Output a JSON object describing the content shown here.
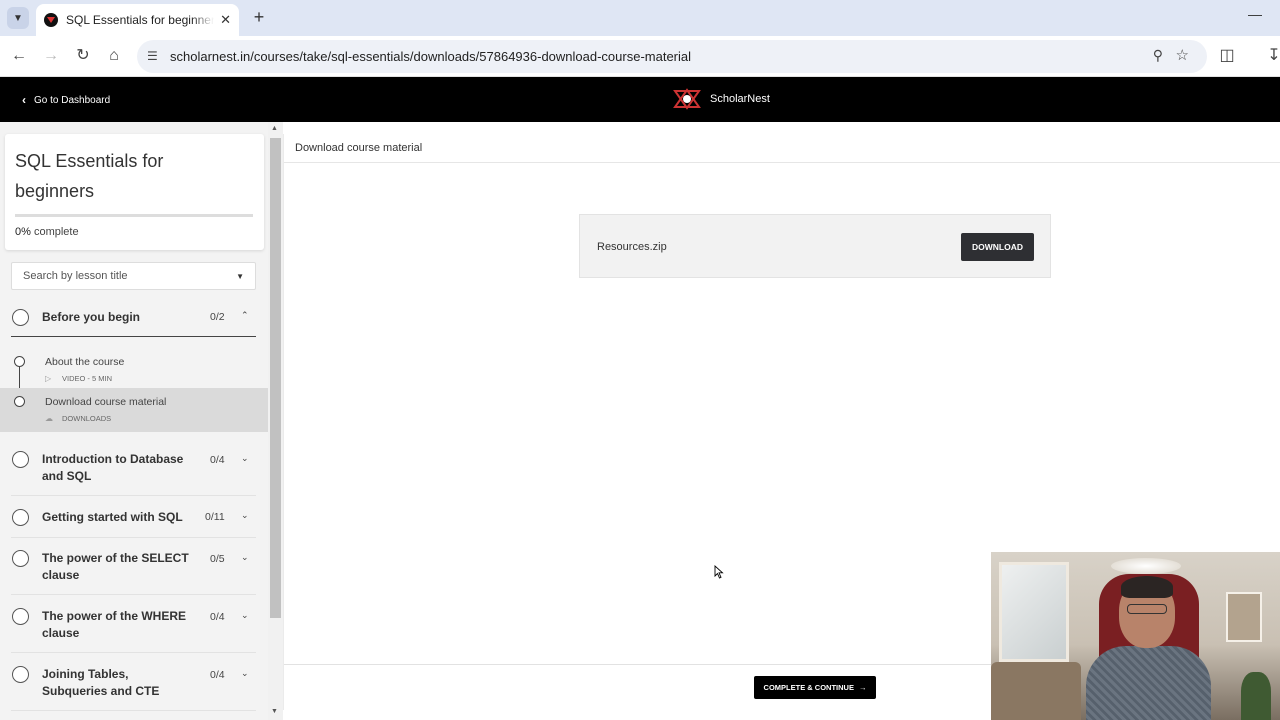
{
  "browser": {
    "tab_title": "SQL Essentials for beginners - S",
    "url": "scholarnest.in/courses/take/sql-essentials/downloads/57864936-download-course-material"
  },
  "header": {
    "back_label": "Go to Dashboard",
    "brand_name": "ScholarNest"
  },
  "sidebar": {
    "course_title": "SQL Essentials for beginners",
    "progress_percent": "0%",
    "progress_value": 0,
    "progress_suffix": "complete",
    "search_placeholder": "Search by lesson title",
    "sections": [
      {
        "title": "Before you begin",
        "count": "0/2",
        "expanded": true,
        "lessons": [
          {
            "title": "About the course",
            "meta": "VIDEO - 5 MIN",
            "icon": "video-icon"
          },
          {
            "title": "Download course material",
            "meta": "DOWNLOADS",
            "icon": "cloud-download-icon",
            "active": true
          }
        ]
      },
      {
        "title": "Introduction to Database and SQL",
        "count": "0/4"
      },
      {
        "title": "Getting started with SQL",
        "count": "0/11"
      },
      {
        "title": "The power of the SELECT clause",
        "count": "0/5"
      },
      {
        "title": "The power of the WHERE clause",
        "count": "0/4"
      },
      {
        "title": "Joining Tables, Subqueries and CTE",
        "count": "0/4"
      }
    ]
  },
  "main": {
    "page_title": "Download course material",
    "file_name": "Resources.zip",
    "download_label": "DOWNLOAD",
    "complete_label": "COMPLETE & CONTINUE"
  },
  "colors": {
    "header_bg": "#000000",
    "button_dark": "#2e2f33",
    "active_lesson_bg": "#dadada"
  }
}
